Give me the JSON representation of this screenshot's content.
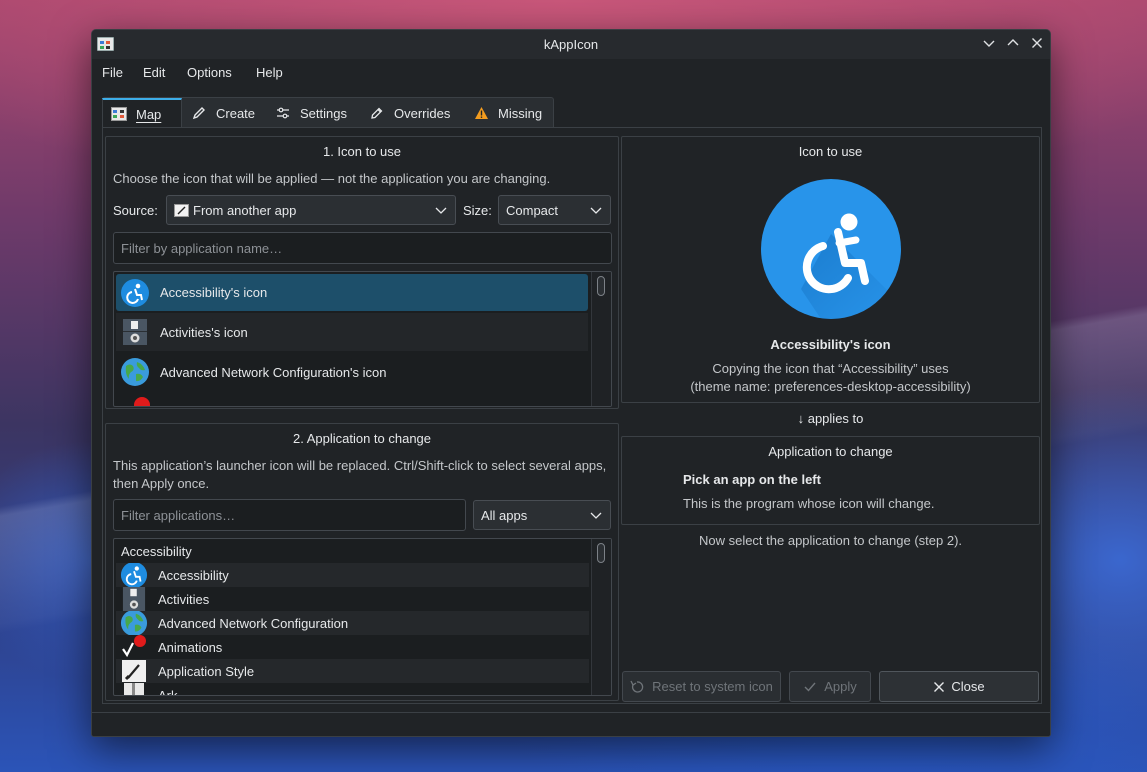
{
  "window": {
    "title": "kAppIcon"
  },
  "menu": {
    "file": "File",
    "edit": "Edit",
    "options": "Options",
    "help": "Help"
  },
  "tabs": [
    {
      "label": "Map",
      "icon": "map-icon"
    },
    {
      "label": "Create",
      "icon": "pencil-icon"
    },
    {
      "label": "Settings",
      "icon": "sliders-icon"
    },
    {
      "label": "Overrides",
      "icon": "edit-icon"
    },
    {
      "label": "Missing",
      "icon": "warning-icon"
    }
  ],
  "icon_panel": {
    "title": "1. Icon to use",
    "description": "Choose the icon that will be applied — not the application you are changing.",
    "source_label": "Source:",
    "source_value": "From another app",
    "size_label": "Size:",
    "size_value": "Compact",
    "filter_placeholder": "Filter by application name…",
    "items": [
      {
        "label": "Accessibility's icon",
        "selected": true
      },
      {
        "label": "Activities's icon",
        "selected": false
      },
      {
        "label": "Advanced Network Configuration's icon",
        "selected": false
      }
    ]
  },
  "app_panel": {
    "title": "2. Application to change",
    "description": "This application’s launcher icon will be replaced. Ctrl/Shift-click to select several apps, then Apply once.",
    "filter_placeholder": "Filter applications…",
    "category_value": "All apps",
    "group_header": "Accessibility",
    "items": [
      {
        "label": "Accessibility"
      },
      {
        "label": "Activities"
      },
      {
        "label": "Advanced Network Configuration"
      },
      {
        "label": "Animations"
      },
      {
        "label": "Application Style"
      },
      {
        "label": "Ark"
      }
    ]
  },
  "preview": {
    "title": "Icon to use",
    "icon_name": "Accessibility's icon",
    "copy_line": "Copying the icon that “Accessibility” uses",
    "theme_line": "(theme name: preferences-desktop-accessibility)",
    "applies_to": "↓ applies to",
    "target_title": "Application to change",
    "target_heading": "Pick an app on the left",
    "target_desc": "This is the program whose icon will change.",
    "hint": "Now select the application to change (step 2)."
  },
  "buttons": {
    "reset": "Reset to system icon",
    "apply": "Apply",
    "close": "Close"
  },
  "colors": {
    "accent": "#3daee9",
    "selection": "#1d4f6a",
    "accessibility_blue": "#1e8ce0"
  }
}
